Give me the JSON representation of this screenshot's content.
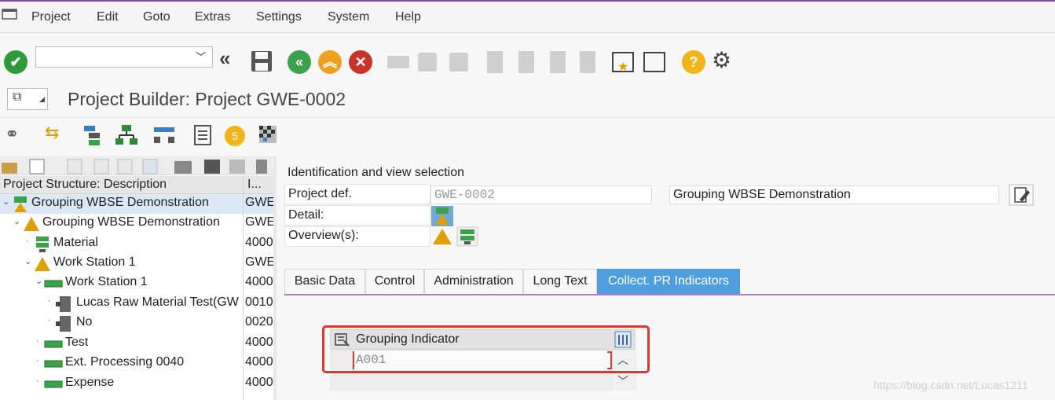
{
  "menu": {
    "items": [
      "Project",
      "Edit",
      "Goto",
      "Extras",
      "Settings",
      "System",
      "Help"
    ]
  },
  "toolbar": {
    "command_value": ""
  },
  "title": {
    "text": "Project Builder: Project GWE-0002"
  },
  "tree": {
    "header_description": "Project Structure: Description",
    "header_id": "I...",
    "rows": [
      {
        "label": "Grouping WBSE Demonstration",
        "id": "GWE",
        "icon": "project-definition-icon"
      },
      {
        "label": "Grouping WBSE Demonstration",
        "id": "GWE",
        "icon": "wbs-element-icon"
      },
      {
        "label": "Material",
        "id": "4000",
        "icon": "material-component-icon"
      },
      {
        "label": "Work Station 1",
        "id": "GWE",
        "icon": "wbs-element-icon"
      },
      {
        "label": "Work Station 1",
        "id": "4000",
        "icon": "network-icon"
      },
      {
        "label": "Lucas Raw Material Test(GW",
        "id": "0010",
        "icon": "activity-icon"
      },
      {
        "label": "No",
        "id": "0020",
        "icon": "activity-icon"
      },
      {
        "label": "Test",
        "id": "4000",
        "icon": "network-icon"
      },
      {
        "label": "Ext. Processing 0040",
        "id": "4000",
        "icon": "network-icon"
      },
      {
        "label": "Expense",
        "id": "4000",
        "icon": "network-icon"
      }
    ]
  },
  "identification": {
    "header": "Identification and view selection",
    "project_def_label": "Project def.",
    "project_def_value": "GWE-0002",
    "project_def_desc": "Grouping WBSE Demonstration",
    "detail_label": "Detail:",
    "overview_label": "Overview(s):"
  },
  "tabs": [
    {
      "label": "Basic Data"
    },
    {
      "label": "Control"
    },
    {
      "label": "Administration"
    },
    {
      "label": "Long Text"
    },
    {
      "label": "Collect. PR Indicators"
    }
  ],
  "grouping": {
    "title": "Grouping Indicator",
    "value": "A001"
  },
  "watermark": "https://blog.csdn.net/Lucas1211",
  "colors": {
    "accent_purple": "#8a4aa0",
    "active_tab": "#4f9fde",
    "highlight_red": "#d93a2b",
    "ok_green": "#2e9a3a",
    "back_green": "#3aa34a",
    "exit_orange": "#f0a020",
    "cancel_red": "#c8342a",
    "help_yellow": "#f2b418"
  }
}
